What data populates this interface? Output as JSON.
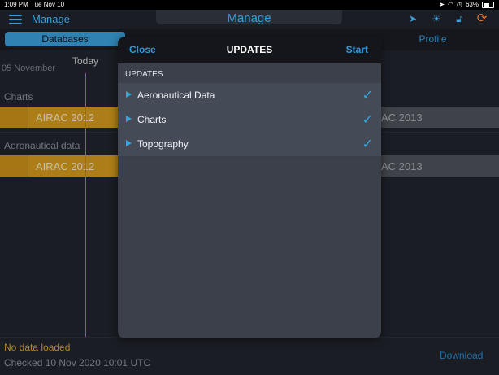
{
  "status": {
    "time": "1:09 PM",
    "date": "Tue Nov 10",
    "battery": "63%"
  },
  "nav": {
    "left_title": "Manage",
    "title": "Manage"
  },
  "tabs": {
    "databases": "Databases",
    "profile": "Profile"
  },
  "timeline": {
    "date": "05 November",
    "today": "Today"
  },
  "sections": [
    {
      "label": "Charts",
      "current": "AIRAC 2012",
      "next": "AC 2013"
    },
    {
      "label": "Aeronautical data",
      "current": "AIRAC 2012",
      "next": "AC 2013"
    }
  ],
  "footer": {
    "no_data": "No data loaded",
    "checked": "Checked 10 Nov 2020 10:01 UTC",
    "download": "Download"
  },
  "modal": {
    "close": "Close",
    "title": "UPDATES",
    "start": "Start",
    "section": "UPDATES",
    "items": [
      {
        "label": "Aeronautical Data",
        "checked": true
      },
      {
        "label": "Charts",
        "checked": true
      },
      {
        "label": "Topography",
        "checked": true
      }
    ]
  },
  "colors": {
    "accent": "#3b9ed8",
    "airac_current": "#d39a1e",
    "sync": "#e8732a",
    "warning_text": "#d9a33a"
  }
}
